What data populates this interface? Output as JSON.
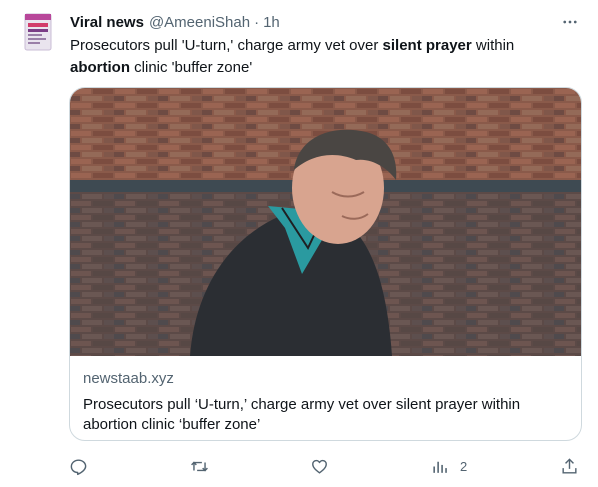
{
  "author": {
    "name": "Viral news",
    "handle": "@AmeeniShah",
    "separator": "·",
    "time": "1h"
  },
  "tweet": {
    "segments": [
      "Prosecutors pull 'U-turn,' charge army vet over ",
      "silent prayer",
      " within ",
      "abortion",
      " clinic 'buffer zone'"
    ]
  },
  "card": {
    "domain": "newstaab.xyz",
    "title": "Prosecutors pull ‘U-turn,’ charge army vet over silent prayer within abortion clinic ‘buffer zone’"
  },
  "actions": {
    "reply_count": "",
    "retweet_count": "",
    "like_count": "",
    "views_count": "2"
  },
  "icons": [
    "avatar",
    "more-icon",
    "reply-icon",
    "retweet-icon",
    "like-icon",
    "views-icon",
    "share-icon"
  ],
  "colors": {
    "text": "#0f1419",
    "secondary": "#536471",
    "border": "#cfd9de"
  }
}
